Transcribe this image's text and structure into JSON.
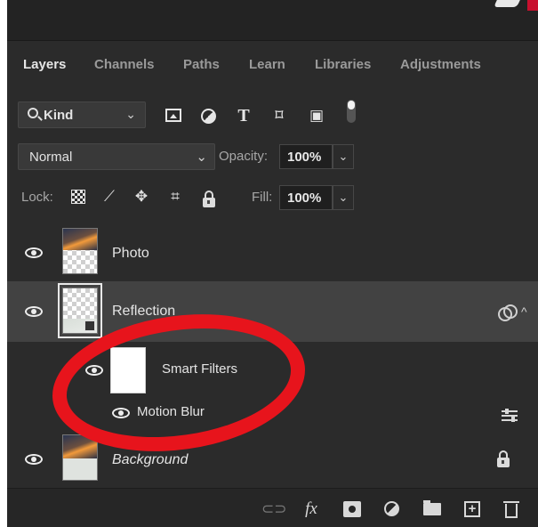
{
  "tabs": [
    {
      "label": "Layers",
      "active": true
    },
    {
      "label": "Channels"
    },
    {
      "label": "Paths"
    },
    {
      "label": "Learn"
    },
    {
      "label": "Libraries"
    },
    {
      "label": "Adjustments"
    }
  ],
  "filter": {
    "kind_label": "Kind",
    "icons": [
      "image-filter-icon",
      "adjustment-filter-icon",
      "type-filter-icon",
      "shape-filter-icon",
      "smart-object-filter-icon",
      "filter-toggle"
    ]
  },
  "blend": {
    "mode": "Normal",
    "opacity_label": "Opacity:",
    "opacity_value": "100%"
  },
  "lock": {
    "label": "Lock:",
    "fill_label": "Fill:",
    "fill_value": "100%",
    "icons": [
      "lock-transparent-pixels-icon",
      "lock-image-pixels-icon",
      "lock-position-icon",
      "lock-artboard-icon",
      "lock-all-icon"
    ]
  },
  "layers": [
    {
      "name": "Photo",
      "visible": true,
      "selected": false
    },
    {
      "name": "Reflection",
      "visible": true,
      "selected": true,
      "smart_object": true
    },
    {
      "name": "Smart Filters",
      "visible": true,
      "type": "smart-filters"
    },
    {
      "name": "Motion Blur",
      "visible": true,
      "type": "filter"
    },
    {
      "name": "Background",
      "visible": true,
      "locked": true,
      "italic": true
    }
  ],
  "annotation": {
    "shape": "oval",
    "color": "#e7141c"
  },
  "bottom_icons": [
    "link-layers-icon",
    "fx-icon",
    "layer-mask-icon",
    "adjustment-layer-icon",
    "group-folder-icon",
    "new-layer-icon",
    "trash-icon"
  ],
  "fx_label": "fx"
}
